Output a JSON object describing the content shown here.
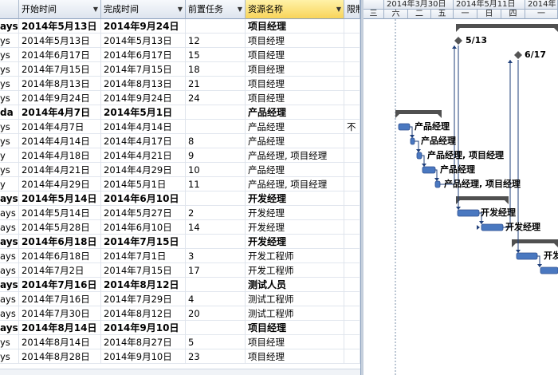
{
  "columns": [
    {
      "label": ""
    },
    {
      "label": "开始时间",
      "dropdown": true
    },
    {
      "label": "完成时间",
      "dropdown": true
    },
    {
      "label": "前置任务",
      "dropdown": true
    },
    {
      "label": "资源名称",
      "dropdown": true,
      "selected": true
    },
    {
      "label": "限制"
    }
  ],
  "rows": [
    {
      "dur": "ays",
      "start": "2014年5月13日",
      "finish": "2014年9月24日",
      "pred": "",
      "res": "项目经理",
      "extra": "",
      "summary": true
    },
    {
      "dur": "ys",
      "start": "2014年5月13日",
      "finish": "2014年5月13日",
      "pred": "12",
      "res": "项目经理",
      "extra": "",
      "summary": false
    },
    {
      "dur": "ys",
      "start": "2014年6月17日",
      "finish": "2014年6月17日",
      "pred": "15",
      "res": "项目经理",
      "extra": "",
      "summary": false
    },
    {
      "dur": "ys",
      "start": "2014年7月15日",
      "finish": "2014年7月15日",
      "pred": "18",
      "res": "项目经理",
      "extra": "",
      "summary": false
    },
    {
      "dur": "ys",
      "start": "2014年8月13日",
      "finish": "2014年8月13日",
      "pred": "21",
      "res": "项目经理",
      "extra": "",
      "summary": false
    },
    {
      "dur": "ys",
      "start": "2014年9月24日",
      "finish": "2014年9月24日",
      "pred": "24",
      "res": "项目经理",
      "extra": "",
      "summary": false
    },
    {
      "dur": "da",
      "start": "2014年4月7日",
      "finish": "2014年5月1日",
      "pred": "",
      "res": "产品经理",
      "extra": "",
      "summary": true
    },
    {
      "dur": "ys",
      "start": "2014年4月7日",
      "finish": "2014年4月14日",
      "pred": "",
      "res": "产品经理",
      "extra": "不",
      "summary": false
    },
    {
      "dur": "ys",
      "start": "2014年4月14日",
      "finish": "2014年4月17日",
      "pred": "8",
      "res": "产品经理",
      "extra": "",
      "summary": false
    },
    {
      "dur": "y",
      "start": "2014年4月18日",
      "finish": "2014年4月21日",
      "pred": "9",
      "res": "产品经理, 项目经理",
      "extra": "",
      "summary": false
    },
    {
      "dur": "ys",
      "start": "2014年4月21日",
      "finish": "2014年4月29日",
      "pred": "10",
      "res": "产品经理",
      "extra": "",
      "summary": false
    },
    {
      "dur": "y",
      "start": "2014年4月29日",
      "finish": "2014年5月1日",
      "pred": "11",
      "res": "产品经理, 项目经理",
      "extra": "",
      "summary": false
    },
    {
      "dur": "ays",
      "start": "2014年5月14日",
      "finish": "2014年6月10日",
      "pred": "",
      "res": "开发经理",
      "extra": "",
      "summary": true
    },
    {
      "dur": "ays",
      "start": "2014年5月14日",
      "finish": "2014年5月27日",
      "pred": "2",
      "res": "开发经理",
      "extra": "",
      "summary": false
    },
    {
      "dur": "ays",
      "start": "2014年5月28日",
      "finish": "2014年6月10日",
      "pred": "14",
      "res": "开发经理",
      "extra": "",
      "summary": false
    },
    {
      "dur": "ays",
      "start": "2014年6月18日",
      "finish": "2014年7月15日",
      "pred": "",
      "res": "开发经理",
      "extra": "",
      "summary": true
    },
    {
      "dur": "ays",
      "start": "2014年6月18日",
      "finish": "2014年7月1日",
      "pred": "3",
      "res": "开发工程师",
      "extra": "",
      "summary": false
    },
    {
      "dur": "ays",
      "start": "2014年7月2日",
      "finish": "2014年7月15日",
      "pred": "17",
      "res": "开发工程师",
      "extra": "",
      "summary": false
    },
    {
      "dur": "ays",
      "start": "2014年7月16日",
      "finish": "2014年8月12日",
      "pred": "",
      "res": "测试人员",
      "extra": "",
      "summary": true
    },
    {
      "dur": "ays",
      "start": "2014年7月16日",
      "finish": "2014年7月29日",
      "pred": "4",
      "res": "测试工程师",
      "extra": "",
      "summary": false
    },
    {
      "dur": "ays",
      "start": "2014年7月30日",
      "finish": "2014年8月12日",
      "pred": "20",
      "res": "测试工程师",
      "extra": "",
      "summary": false
    },
    {
      "dur": "ays",
      "start": "2014年8月14日",
      "finish": "2014年9月10日",
      "pred": "",
      "res": "项目经理",
      "extra": "",
      "summary": true
    },
    {
      "dur": "ys",
      "start": "2014年8月14日",
      "finish": "2014年8月27日",
      "pred": "5",
      "res": "项目经理",
      "extra": "",
      "summary": false
    },
    {
      "dur": "ys",
      "start": "2014年8月28日",
      "finish": "2014年9月10日",
      "pred": "23",
      "res": "项目经理",
      "extra": "",
      "summary": false
    }
  ],
  "timescale": {
    "weeks": [
      "",
      "2014年3月30日",
      "2014年5月11日",
      "2014年"
    ],
    "days": [
      "三",
      "六",
      "二",
      "五",
      "一",
      "日",
      "四",
      "一"
    ]
  },
  "gantt": {
    "milestones": [
      {
        "row": 1,
        "label": "5/13"
      },
      {
        "row": 2,
        "label": "6/17"
      }
    ],
    "bar_labels": [
      {
        "row": 7,
        "text": "产品经理"
      },
      {
        "row": 8,
        "text": "产品经理"
      },
      {
        "row": 9,
        "text": "产品经理, 项目经理"
      },
      {
        "row": 10,
        "text": "产品经理"
      },
      {
        "row": 11,
        "text": "产品经理, 项目经理"
      },
      {
        "row": 13,
        "text": "开发经理"
      },
      {
        "row": 14,
        "text": "开发经理"
      },
      {
        "row": 16,
        "text": "开发"
      }
    ],
    "colors": {
      "task": "#4a78c0",
      "summary": "#505050",
      "link": "#1f3f7a"
    }
  }
}
